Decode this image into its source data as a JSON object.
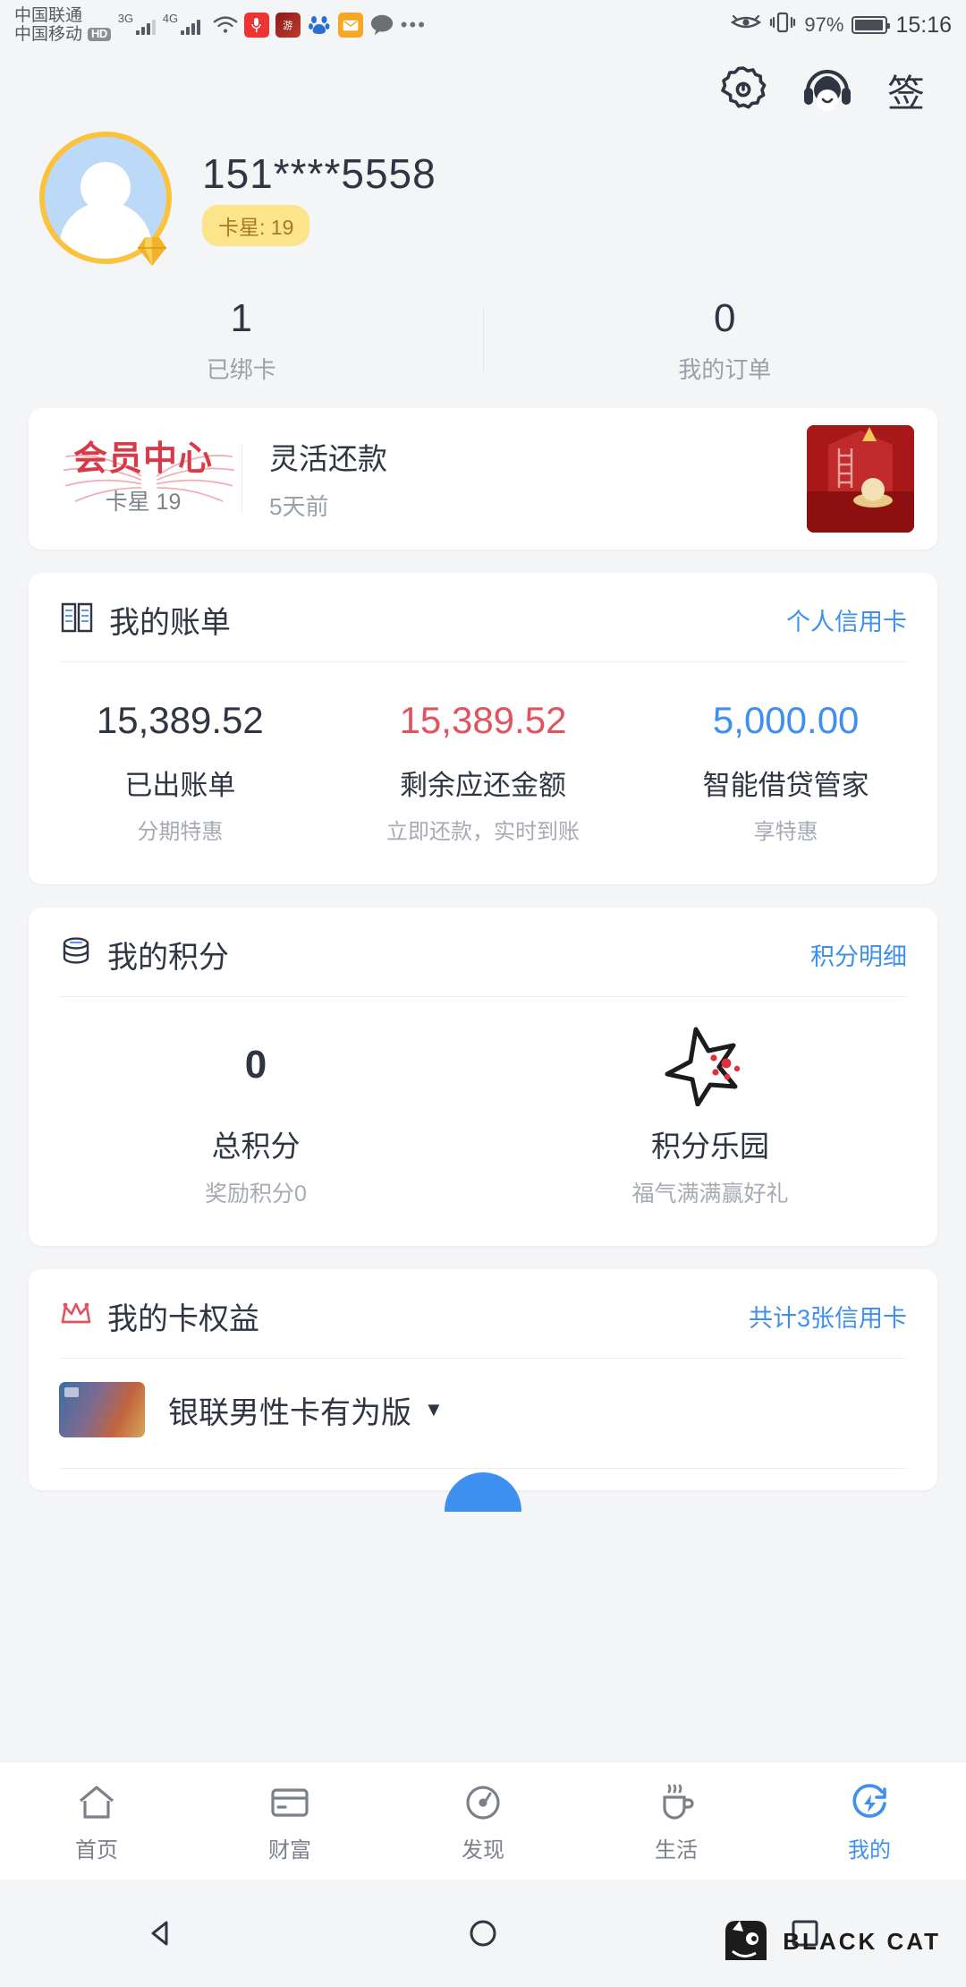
{
  "statusbar": {
    "carrier1": "中国联通",
    "carrier2": "中国移动",
    "hd": "HD",
    "net1": "3G",
    "net2": "4G",
    "net2_sup": "+",
    "battery_percent": "97%",
    "time": "15:16",
    "more": "•••",
    "icons": [
      "wifi-icon",
      "microphone-icon",
      "game-icon",
      "baidu-icon",
      "mail-icon",
      "chat-icon",
      "eye-icon",
      "vibrate-icon",
      "battery-icon"
    ]
  },
  "header": {
    "settings_icon": "gear-icon",
    "service_icon": "headset-icon",
    "sign_label": "签"
  },
  "profile": {
    "phone": "151****5558",
    "star_badge": "卡星: 19",
    "avatar_icon": "user-avatar-icon"
  },
  "stats": [
    {
      "value": "1",
      "label": "已绑卡"
    },
    {
      "value": "0",
      "label": "我的订单"
    }
  ],
  "member_banner": {
    "logo": "会员中心",
    "logo_sub": "卡星 19",
    "title": "灵活还款",
    "subtitle": "5天前",
    "thumb_icon": "promo-thumbnail"
  },
  "bill": {
    "icon": "ledger-icon",
    "title": "我的账单",
    "link": "个人信用卡",
    "columns": [
      {
        "amount": "15,389.52",
        "label": "已出账单",
        "sub": "分期特惠",
        "color": "dark"
      },
      {
        "amount": "15,389.52",
        "label": "剩余应还金额",
        "sub": "立即还款，实时到账",
        "color": "red"
      },
      {
        "amount": "5,000.00",
        "label": "智能借贷管家",
        "sub": "享特惠",
        "color": "blue"
      }
    ]
  },
  "points": {
    "icon": "coins-icon",
    "title": "我的积分",
    "link": "积分明细",
    "total_value": "0",
    "total_label": "总积分",
    "total_sub": "奖励积分0",
    "park_label": "积分乐园",
    "park_sub": "福气满满赢好礼",
    "park_icon": "star-park-icon"
  },
  "rights": {
    "icon": "crown-icon",
    "title": "我的卡权益",
    "link": "共计3张信用卡",
    "card_name": "银联男性卡有为版",
    "caret_icon": "chevron-down-icon",
    "card_icon": "credit-card-thumbnail"
  },
  "bottom_nav": [
    {
      "label": "首页",
      "icon": "home-icon",
      "active": false
    },
    {
      "label": "财富",
      "icon": "wallet-icon",
      "active": false
    },
    {
      "label": "发现",
      "icon": "compass-icon",
      "active": false
    },
    {
      "label": "生活",
      "icon": "cup-icon",
      "active": false
    },
    {
      "label": "我的",
      "icon": "my-icon",
      "active": true
    }
  ],
  "system_nav": {
    "back": "back-triangle-icon",
    "home": "home-circle-icon",
    "recents": "recents-square-icon"
  },
  "watermark": {
    "text": "BLACK CAT",
    "icon": "black-cat-logo"
  },
  "colors": {
    "accent_blue": "#3d8ff0",
    "amount_red": "#e2535f",
    "badge_gold": "#fbe48a",
    "avatar_ring": "#fbc23b",
    "page_bg": "#f4f5f7"
  }
}
